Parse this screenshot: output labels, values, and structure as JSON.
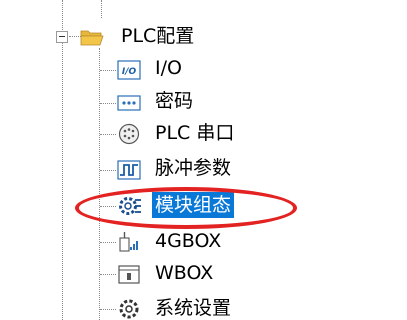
{
  "tree": {
    "parent": {
      "label": "PLC配置",
      "icon": "folder-open-icon",
      "expanded": true
    },
    "items": [
      {
        "label": "I/O",
        "icon": "io-icon"
      },
      {
        "label": "密码",
        "icon": "password-icon"
      },
      {
        "label": "PLC 串口",
        "icon": "serial-port-icon"
      },
      {
        "label": "脉冲参数",
        "icon": "pulse-icon"
      },
      {
        "label": "模块组态",
        "icon": "module-config-icon",
        "selected": true
      },
      {
        "label": "4GBOX",
        "icon": "4gbox-icon"
      },
      {
        "label": "WBOX",
        "icon": "wbox-icon"
      },
      {
        "label": "系统设置",
        "icon": "gear-icon"
      }
    ]
  },
  "colors": {
    "selection": "#0a78d7",
    "annotation": "#e32222",
    "folder": "#f3c64a"
  }
}
